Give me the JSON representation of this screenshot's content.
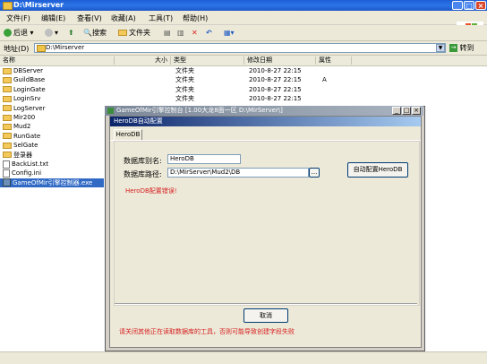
{
  "explorer": {
    "title": "D:\\Mirserver",
    "menus": [
      "文件(F)",
      "编辑(E)",
      "查看(V)",
      "收藏(A)",
      "工具(T)",
      "帮助(H)"
    ],
    "toolbar": {
      "back": "后退",
      "search": "搜索",
      "folders": "文件夹"
    },
    "address_label": "地址(D)",
    "address_value": "D:\\Mirserver",
    "go_label": "转到",
    "columns": [
      "名称",
      "大小",
      "类型",
      "修改日期",
      "属性"
    ],
    "files": [
      {
        "name": "DBServer",
        "icon": "folder",
        "type": "文件夹",
        "date": "2010-8-27 22:15",
        "attr": ""
      },
      {
        "name": "GuildBase",
        "icon": "folder",
        "type": "文件夹",
        "date": "2010-8-27 22:15",
        "attr": "A"
      },
      {
        "name": "LoginGate",
        "icon": "folder",
        "type": "文件夹",
        "date": "2010-8-27 22:15",
        "attr": ""
      },
      {
        "name": "LoginSrv",
        "icon": "folder",
        "type": "文件夹",
        "date": "2010-8-27 22:15",
        "attr": ""
      },
      {
        "name": "LogServer",
        "icon": "folder",
        "type": "",
        "date": "",
        "attr": ""
      },
      {
        "name": "Mir200",
        "icon": "folder",
        "type": "",
        "date": "",
        "attr": ""
      },
      {
        "name": "Mud2",
        "icon": "folder",
        "type": "",
        "date": "",
        "attr": ""
      },
      {
        "name": "RunGate",
        "icon": "folder",
        "type": "",
        "date": "",
        "attr": ""
      },
      {
        "name": "SelGate",
        "icon": "folder",
        "type": "",
        "date": "",
        "attr": ""
      },
      {
        "name": "登录器",
        "icon": "folder",
        "type": "",
        "date": "",
        "attr": ""
      },
      {
        "name": "BackList.txt",
        "icon": "document",
        "type": "",
        "date": "",
        "attr": ""
      },
      {
        "name": "Config.ini",
        "icon": "settings-file",
        "type": "",
        "date": "",
        "attr": ""
      },
      {
        "name": "GameOfMir引擎控制器.exe",
        "icon": "exe",
        "type": "",
        "date": "",
        "attr": "",
        "selected": true
      }
    ]
  },
  "control_window": {
    "title": "GameOfMir引擎控制台 [1.00大龙8面一区 D:\\MirServer\\]"
  },
  "dialog": {
    "title": "HeroDB自动配置",
    "tab": "HeroDB",
    "alias_label": "数据库别名:",
    "alias_value": "HeroDB",
    "path_label": "数据库路径:",
    "path_value": "D:\\MirServer\\Mud2\\DB",
    "browse_label": "...",
    "auto_config_button": "自动配置HeroDB",
    "error_text": "HeroDB配置错误!",
    "cancel_button": "取消",
    "warning_text": "请关闭其他正在读取数据库的工具，否则可能导致创建字段失败"
  }
}
